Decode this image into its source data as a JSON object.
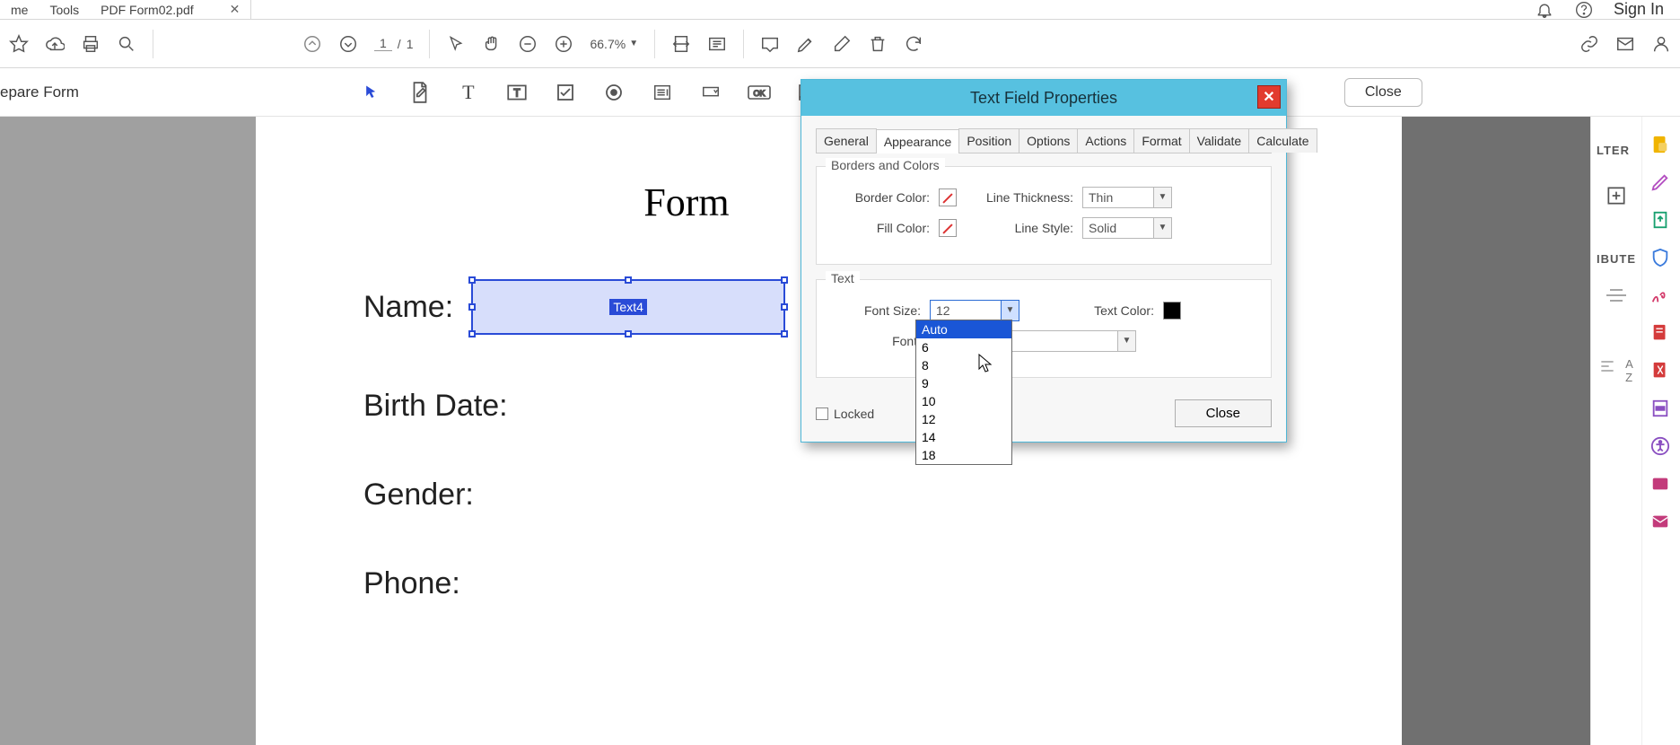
{
  "tabs": {
    "home": "me",
    "tools": "Tools",
    "doc": "PDF Form02.pdf",
    "signin": "Sign In"
  },
  "toolbar": {
    "page_current": "1",
    "page_sep": "/",
    "page_total": "1",
    "zoom": "66.7%"
  },
  "modebar": {
    "label": "epare Form",
    "close": "Close"
  },
  "document": {
    "title": "Form",
    "rows": {
      "name": "Name:",
      "birth": "Birth Date:",
      "gender": "Gender:",
      "phone": "Phone:"
    },
    "field_badge": "Text4"
  },
  "rightpanel": {
    "hdr1": "LTER",
    "hdr2": "IBUTE"
  },
  "dialog": {
    "title": "Text Field Properties",
    "tabs": [
      "General",
      "Appearance",
      "Position",
      "Options",
      "Actions",
      "Format",
      "Validate",
      "Calculate"
    ],
    "active_tab": "Appearance",
    "group_borders": "Borders and Colors",
    "border_color": "Border Color:",
    "fill_color": "Fill Color:",
    "line_thickness": "Line Thickness:",
    "line_thickness_val": "Thin",
    "line_style": "Line Style:",
    "line_style_val": "Solid",
    "group_text": "Text",
    "font_size": "Font Size:",
    "font_size_val": "12",
    "font": "Font:",
    "font_val": "",
    "text_color": "Text Color:",
    "size_options": [
      "Auto",
      "6",
      "8",
      "9",
      "10",
      "12",
      "14",
      "18"
    ],
    "locked": "Locked",
    "close": "Close"
  }
}
